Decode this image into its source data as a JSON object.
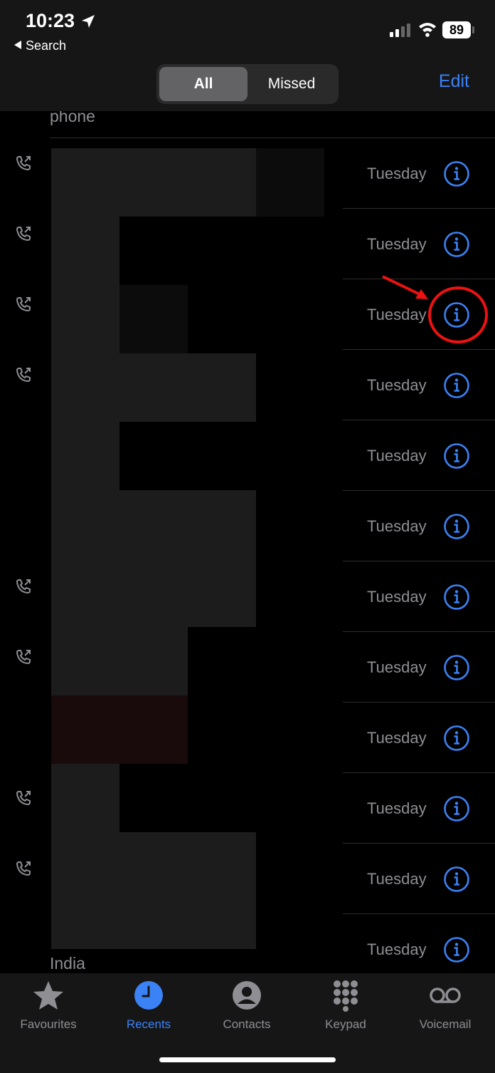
{
  "status_bar": {
    "time": "10:23",
    "battery": "89"
  },
  "header": {
    "back": "Search",
    "segments": [
      "All",
      "Missed"
    ],
    "active_segment": "All",
    "edit": "Edit"
  },
  "list": {
    "first_row_label": "phone",
    "last_row_label": "India",
    "rows": [
      {
        "day": "Tuesday",
        "has_call_icon": true
      },
      {
        "day": "Tuesday",
        "has_call_icon": true
      },
      {
        "day": "Tuesday",
        "has_call_icon": true
      },
      {
        "day": "Tuesday",
        "has_call_icon": true
      },
      {
        "day": "Tuesday",
        "has_call_icon": false
      },
      {
        "day": "Tuesday",
        "has_call_icon": false
      },
      {
        "day": "Tuesday",
        "has_call_icon": true
      },
      {
        "day": "Tuesday",
        "has_call_icon": true
      },
      {
        "day": "Tuesday",
        "has_call_icon": false
      },
      {
        "day": "Tuesday",
        "has_call_icon": true
      },
      {
        "day": "Tuesday",
        "has_call_icon": true
      },
      {
        "day": "Tuesday",
        "has_call_icon": false
      }
    ]
  },
  "tabs": [
    {
      "label": "Favourites",
      "icon": "star-icon",
      "active": false
    },
    {
      "label": "Recents",
      "icon": "clock-icon",
      "active": true
    },
    {
      "label": "Contacts",
      "icon": "person-icon",
      "active": false
    },
    {
      "label": "Keypad",
      "icon": "keypad-icon",
      "active": false
    },
    {
      "label": "Voicemail",
      "icon": "voicemail-icon",
      "active": false
    }
  ],
  "colors": {
    "accent": "#3b82f6",
    "annotation": "#e11111"
  }
}
